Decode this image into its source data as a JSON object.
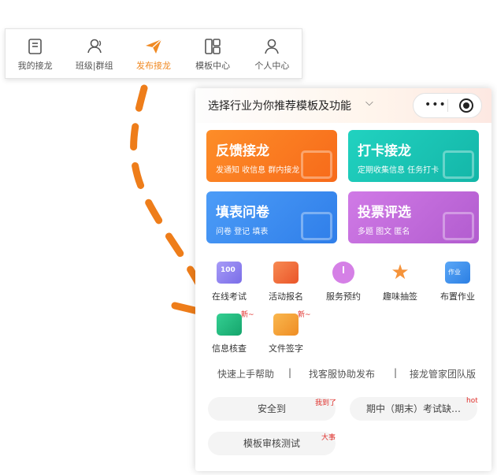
{
  "tabbar": {
    "tabs": [
      {
        "label": "我的接龙",
        "icon": "document-icon"
      },
      {
        "label": "班级|群组",
        "icon": "group-icon"
      },
      {
        "label": "发布接龙",
        "icon": "send-icon"
      },
      {
        "label": "模板中心",
        "icon": "grid-icon"
      },
      {
        "label": "个人中心",
        "icon": "person-icon"
      }
    ],
    "active_index": 2
  },
  "panel": {
    "header": {
      "title": "选择行业为你推荐模板及功能",
      "dropdown_icon": "chevron-down-icon",
      "more_icon": "more-dots-icon",
      "record_icon": "record-icon"
    },
    "cards": [
      {
        "title": "反馈接龙",
        "subtitle": "发通知 收信息 群内接龙",
        "color": "#fb7a1f"
      },
      {
        "title": "打卡接龙",
        "subtitle": "定期收集信息 任务打卡",
        "color": "#19c6b6"
      },
      {
        "title": "填表问卷",
        "subtitle": "问卷 登记 填表",
        "color": "#3e8ff2"
      },
      {
        "title": "投票评选",
        "subtitle": "多题 图文 匿名",
        "color": "#c26ad9"
      }
    ],
    "features_row1": [
      {
        "label": "在线考试",
        "icon": "exam-icon",
        "color": "#8a7ff0"
      },
      {
        "label": "活动报名",
        "icon": "signup-icon",
        "color": "#f26a3c"
      },
      {
        "label": "服务预约",
        "icon": "alarm-clock-icon",
        "color": "#c46ad8"
      },
      {
        "label": "趣味抽签",
        "icon": "star-icon",
        "color": "#f5933a"
      },
      {
        "label": "布置作业",
        "icon": "homework-icon",
        "color": "#3d8fe8"
      }
    ],
    "features_row2": [
      {
        "label": "信息核查",
        "icon": "check-info-icon",
        "color": "#20b97c",
        "tag": "新~"
      },
      {
        "label": "文件签字",
        "icon": "sign-file-icon",
        "color": "#f5a23a",
        "tag": "新~"
      }
    ],
    "links": [
      "快速上手帮助",
      "|",
      "找客服协助发布",
      "|",
      "接龙管家团队版"
    ],
    "pills": [
      {
        "label": "安全到",
        "tag": "我到了"
      },
      {
        "label": "期中（期末）考试缺…",
        "tag": "hot"
      },
      {
        "label": "模板审核测试",
        "tag": "大事"
      }
    ]
  }
}
